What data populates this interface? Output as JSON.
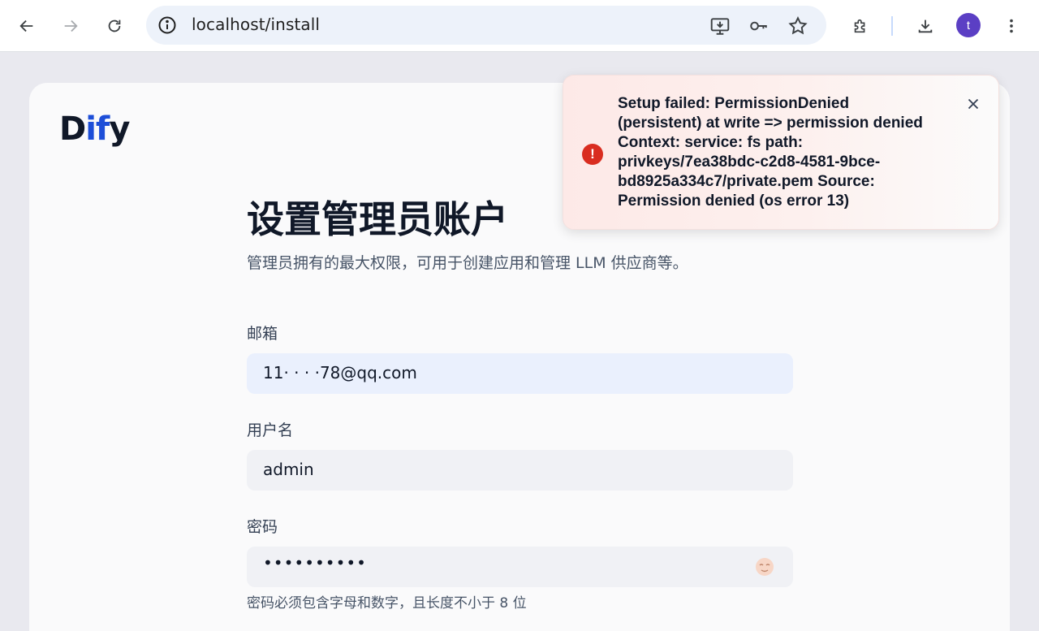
{
  "browser": {
    "url": "localhost/install",
    "avatar_letter": "t"
  },
  "app": {
    "logo_part1": "D",
    "logo_part2": "if",
    "logo_part3": "y"
  },
  "form": {
    "title": "设置管理员账户",
    "subtitle": "管理员拥有的最大权限，可用于创建应用和管理 LLM 供应商等。",
    "email_label": "邮箱",
    "email_value": "11·  ·  · ·78@qq.com",
    "username_label": "用户名",
    "username_value": "admin",
    "password_label": "密码",
    "password_value": "••••••••••",
    "password_hint": "密码必须包含字母和数字，且长度不小于 8 位"
  },
  "toast": {
    "message": "Setup failed: PermissionDenied (persistent) at write => permission denied Context: service: fs path: privkeys/7ea38bdc-c2d8-4581-9bce-bd8925a334c7/private.pem Source: Permission denied (os error 13)"
  }
}
